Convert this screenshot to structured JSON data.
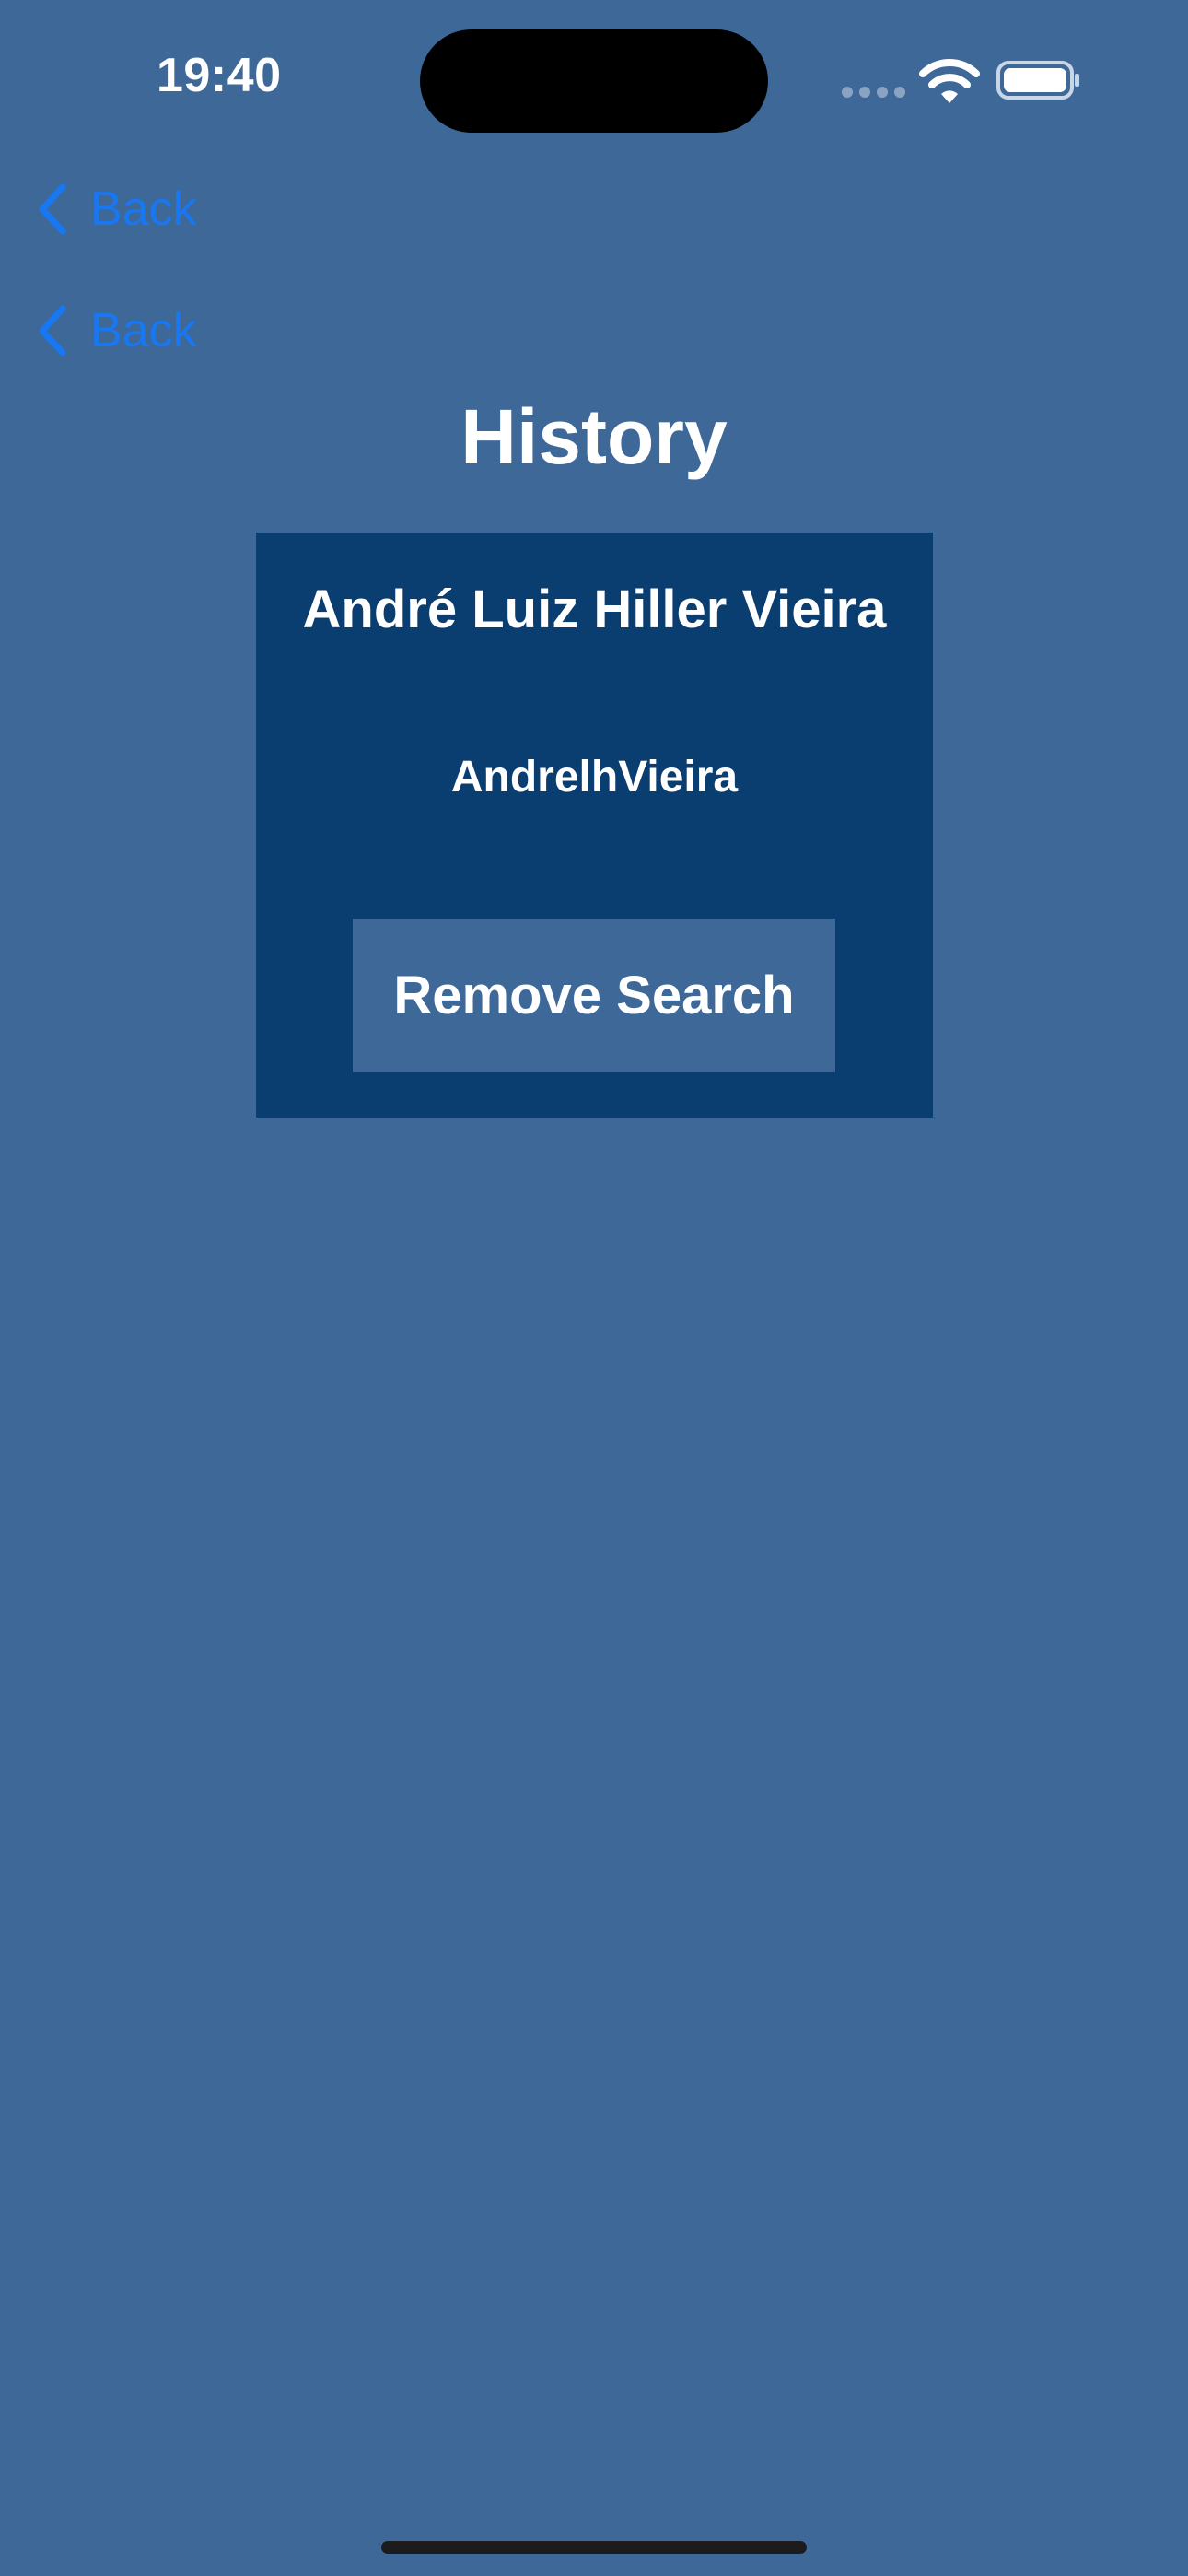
{
  "status_bar": {
    "time": "19:40",
    "icons": [
      "cellular-signal-icon",
      "wifi-icon",
      "battery-icon"
    ]
  },
  "navigation": {
    "back_buttons": [
      {
        "label": "Back"
      },
      {
        "label": "Back"
      }
    ]
  },
  "page": {
    "title": "History"
  },
  "history": {
    "items": [
      {
        "name": "André Luiz Hiller Vieira",
        "login": "AndrelhVieira",
        "remove_label": "Remove Search"
      }
    ]
  },
  "colors": {
    "background": "#3d6898",
    "card": "#0a3d70",
    "button": "#3d6898",
    "link": "#1877f2",
    "text": "#ffffff"
  }
}
